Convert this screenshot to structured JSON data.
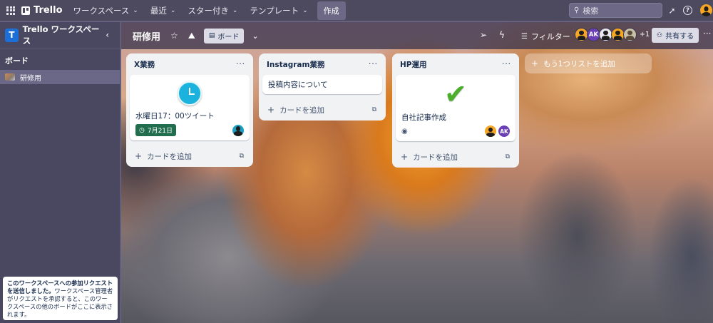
{
  "topbar": {
    "app_name": "Trello",
    "menu": [
      {
        "label": "ワークスペース"
      },
      {
        "label": "最近"
      },
      {
        "label": "スター付き"
      },
      {
        "label": "テンプレート"
      }
    ],
    "create_label": "作成",
    "search_placeholder": "検索",
    "icons": [
      "apps-grid-icon",
      "megaphone-icon",
      "help-icon",
      "account-avatar"
    ]
  },
  "sidebar": {
    "workspace_badge": "T",
    "workspace_name": "Trello ワークスペース",
    "section_title": "ボード",
    "boards": [
      {
        "label": "研修用"
      }
    ],
    "notice_bold": "このワークスペースへの参加リクエストを送信しました。",
    "notice_text": "ワークスペース管理者がリクエストを承認すると、このワークスペースの他のボードがここに表示されます。"
  },
  "board": {
    "title": "研修用",
    "view_label": "ボード",
    "filter_label": "フィルター",
    "members_extra": "+1",
    "member_initials": "AK",
    "share_label": "共有する",
    "add_list_label": "もう1つリストを追加",
    "lists": [
      {
        "title": "X業務",
        "cards": [
          {
            "title": "水曜日17：00ツイート",
            "due": "7月21日",
            "cover": "clock-icon"
          }
        ],
        "add_card": "カードを追加"
      },
      {
        "title": "Instagram業務",
        "cards": [
          {
            "title": "投稿内容について"
          }
        ],
        "add_card": "カードを追加"
      },
      {
        "title": "HP運用",
        "cards": [
          {
            "title": "自社記事作成",
            "cover": "checkmark-icon",
            "member_initials": "AK"
          }
        ],
        "add_card": "カードを追加"
      }
    ]
  },
  "colors": {
    "topbar": "#4d4a5f",
    "sidebar": "#4a4760",
    "accent_blue": "#1c6fd6",
    "due_green": "#216e4e",
    "member_orange": "#f5a623",
    "member_purple": "#6a3fb5"
  }
}
